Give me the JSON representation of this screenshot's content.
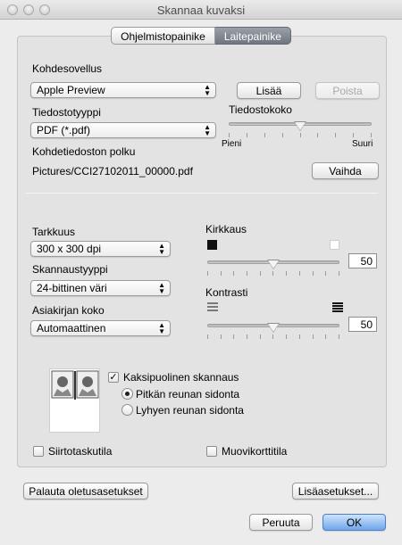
{
  "window": {
    "title": "Skannaa kuvaksi"
  },
  "tabs": [
    {
      "label": "Ohjelmistopainike",
      "selected": false
    },
    {
      "label": "Laitepainike",
      "selected": true
    }
  ],
  "target_app": {
    "label": "Kohdesovellus",
    "value": "Apple Preview",
    "add_button": "Lisää",
    "remove_button": "Poista"
  },
  "file_type": {
    "label": "Tiedostotyyppi",
    "value": "PDF (*.pdf)"
  },
  "file_size": {
    "label": "Tiedostokoko",
    "min_label": "Pieni",
    "max_label": "Suuri",
    "level": 0.5
  },
  "target_path": {
    "label": "Kohdetiedoston polku",
    "value": "Pictures/CCI27102011_00000.pdf",
    "change_button": "Vaihda"
  },
  "resolution": {
    "label": "Tarkkuus",
    "value": "300 x 300 dpi"
  },
  "scan_type": {
    "label": "Skannaustyyppi",
    "value": "24-bittinen väri"
  },
  "document_size": {
    "label": "Asiakirjan koko",
    "value": "Automaattinen"
  },
  "brightness": {
    "label": "Kirkkaus",
    "value": "50",
    "level": 0.5
  },
  "contrast": {
    "label": "Kontrasti",
    "value": "50",
    "level": 0.5
  },
  "duplex": {
    "label": "Kaksipuolinen skannaus",
    "checked": true,
    "options": [
      {
        "label": "Pitkän reunan sidonta",
        "selected": true
      },
      {
        "label": "Lyhyen reunan sidonta",
        "selected": false
      }
    ]
  },
  "carrier_sheet": {
    "label": "Siirtotaskutila",
    "checked": false
  },
  "plastic_card": {
    "label": "Muovikorttitila",
    "checked": false
  },
  "footer": {
    "restore_defaults": "Palauta oletusasetukset",
    "more_settings": "Lisäasetukset...",
    "cancel": "Peruuta",
    "ok": "OK"
  }
}
